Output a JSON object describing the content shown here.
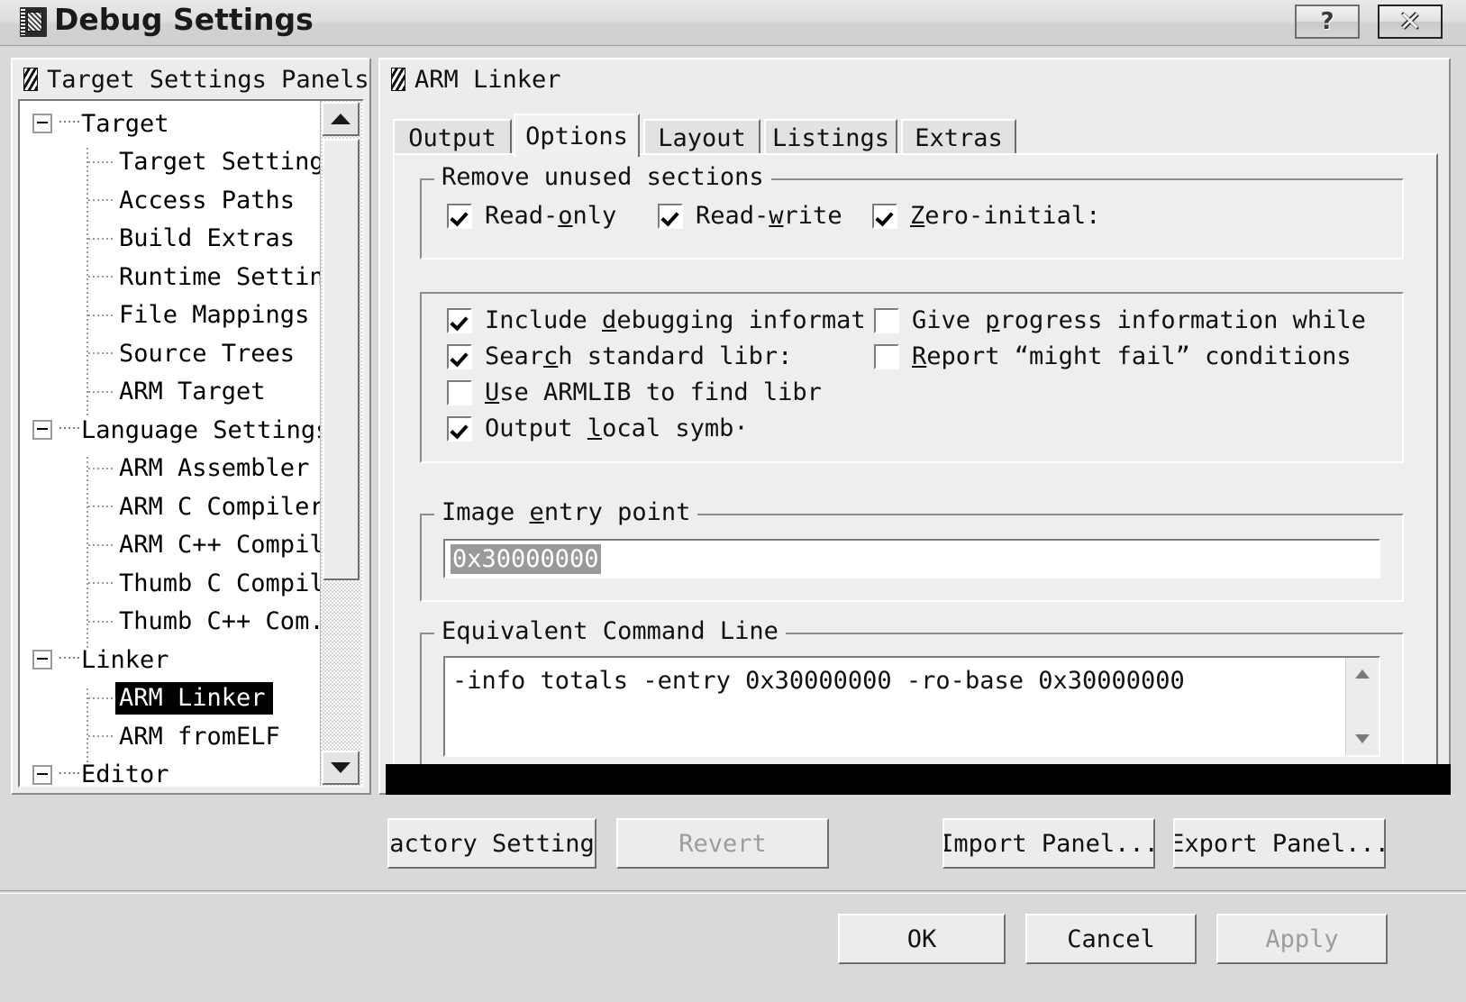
{
  "window": {
    "title": "Debug Settings",
    "help_button": "?",
    "close_button": "✕"
  },
  "left_panel": {
    "title": "Target Settings Panels",
    "tree": [
      {
        "label": "Target",
        "type": "group"
      },
      {
        "label": "Target Settings",
        "type": "child"
      },
      {
        "label": "Access Paths",
        "type": "child"
      },
      {
        "label": "Build Extras",
        "type": "child"
      },
      {
        "label": "Runtime Settings",
        "type": "child"
      },
      {
        "label": "File Mappings",
        "type": "child"
      },
      {
        "label": "Source Trees",
        "type": "child"
      },
      {
        "label": "ARM Target",
        "type": "child"
      },
      {
        "label": "Language Settings",
        "type": "group"
      },
      {
        "label": "ARM Assembler",
        "type": "child"
      },
      {
        "label": "ARM C Compiler",
        "type": "child"
      },
      {
        "label": "ARM C++ Compiler",
        "type": "child"
      },
      {
        "label": "Thumb C Compiler",
        "type": "child"
      },
      {
        "label": "Thumb C++ Com...",
        "type": "child"
      },
      {
        "label": "Linker",
        "type": "group"
      },
      {
        "label": "ARM Linker",
        "type": "child",
        "selected": true
      },
      {
        "label": "ARM fromELF",
        "type": "child"
      },
      {
        "label": "Editor",
        "type": "group"
      }
    ]
  },
  "right_panel": {
    "title": "ARM Linker",
    "tabs": [
      {
        "label": "Output",
        "active": false
      },
      {
        "label": "Options",
        "active": true
      },
      {
        "label": "Layout",
        "active": false
      },
      {
        "label": "Listings",
        "active": false
      },
      {
        "label": "Extras",
        "active": false
      }
    ],
    "remove_unused_sections": {
      "legend": "Remove unused sections",
      "checkboxes": [
        {
          "label_pre": "Read-",
          "label_accel": "o",
          "label_post": "nly",
          "checked": true
        },
        {
          "label_pre": "Read-",
          "label_accel": "w",
          "label_post": "rite",
          "checked": true
        },
        {
          "label_pre": "",
          "label_accel": "Z",
          "label_post": "ero-initial:",
          "checked": true
        }
      ]
    },
    "options_group": {
      "left_checkboxes": [
        {
          "label_pre": "Include ",
          "label_accel": "d",
          "label_post": "ebugging informat",
          "checked": true
        },
        {
          "label_pre": "Sear",
          "label_accel": "c",
          "label_post": "h standard libr:",
          "checked": true
        },
        {
          "label_pre": "",
          "label_accel": "U",
          "label_post": "se ARMLIB to find libr",
          "checked": false
        },
        {
          "label_pre": "Output ",
          "label_accel": "l",
          "label_post": "ocal symb·",
          "checked": true
        }
      ],
      "right_checkboxes": [
        {
          "label_pre": "Give ",
          "label_accel": "p",
          "label_post": "rogress information while",
          "checked": false
        },
        {
          "label_pre": "",
          "label_accel": "R",
          "label_post": "eport “might fail” conditions",
          "checked": false
        }
      ]
    },
    "image_entry_point": {
      "legend_pre": "Image ",
      "legend_accel": "e",
      "legend_post": "ntry point",
      "value": "0x30000000"
    },
    "equivalent_command_line": {
      "legend": "Equivalent Command Line",
      "value": "-info totals -entry 0x30000000 -ro-base 0x30000000"
    }
  },
  "panel_buttons": {
    "factory_settings": "Factory Settings",
    "revert": "Revert",
    "import_panel": "Import Panel...",
    "export_panel": "Export Panel..."
  },
  "dialog_buttons": {
    "ok": "OK",
    "cancel": "Cancel",
    "apply": "Apply"
  }
}
